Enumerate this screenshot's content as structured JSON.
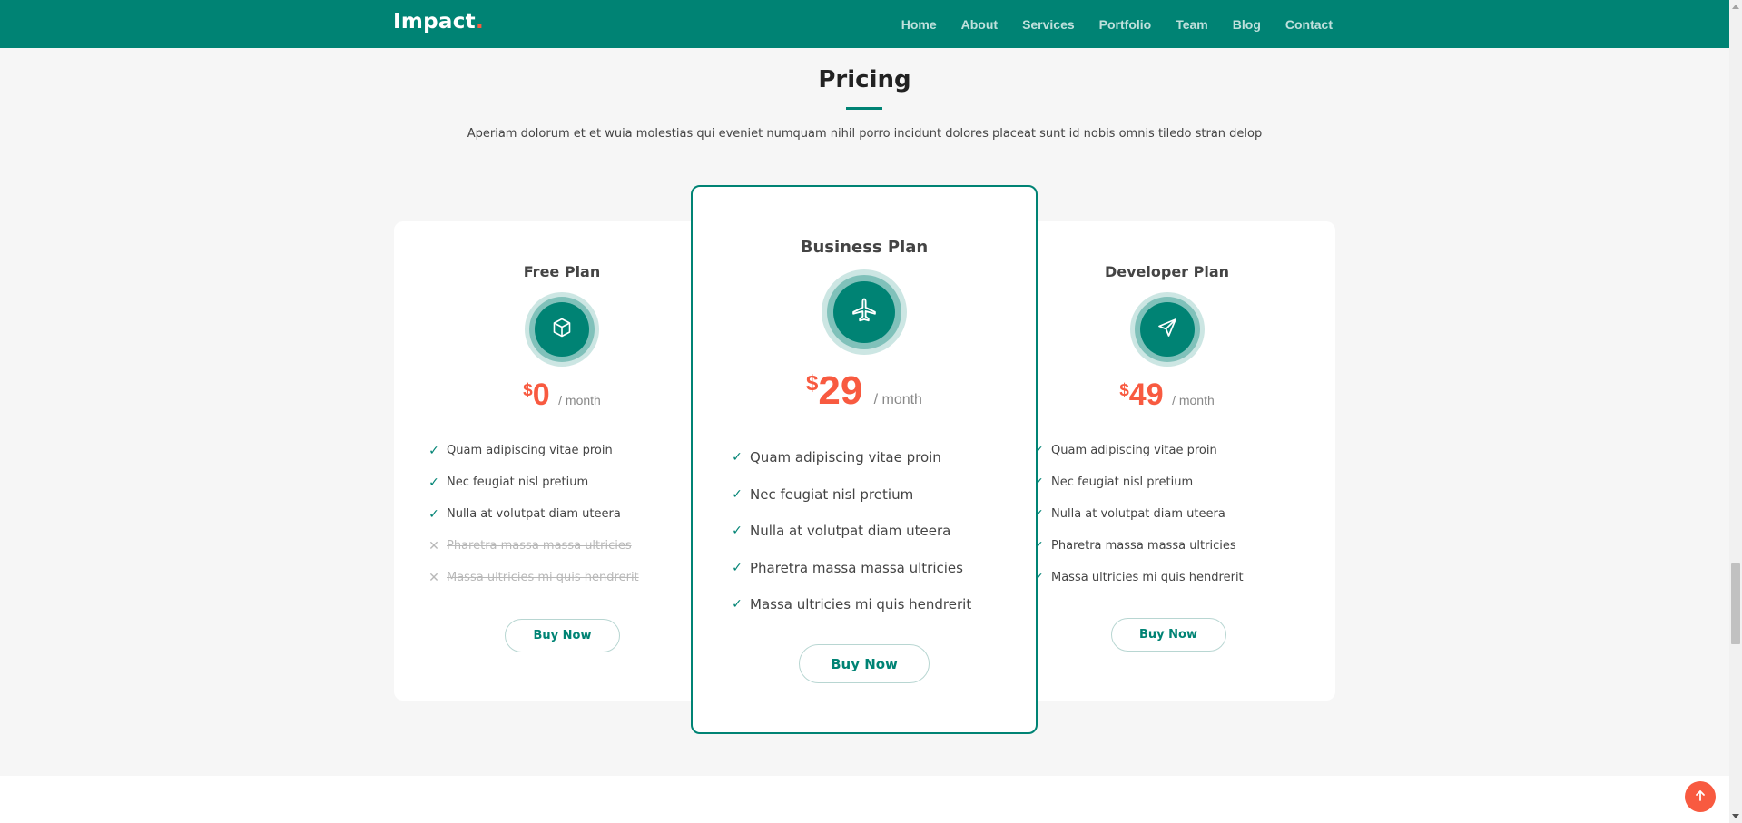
{
  "header": {
    "logo": "Impact",
    "logo_dot": ".",
    "nav": [
      "Home",
      "About",
      "Services",
      "Portfolio",
      "Team",
      "Blog",
      "Contact"
    ]
  },
  "section": {
    "title": "Pricing",
    "subtitle": "Aperiam dolorum et et wuia molestias qui eveniet numquam nihil porro incidunt dolores placeat sunt id nobis omnis tiledo stran delop"
  },
  "plans": [
    {
      "name": "Free Plan",
      "icon": "box-icon",
      "currency": "$",
      "price": "0",
      "period": "/ month",
      "features": [
        {
          "text": "Quam adipiscing vitae proin",
          "included": true
        },
        {
          "text": "Nec feugiat nisl pretium",
          "included": true
        },
        {
          "text": "Nulla at volutpat diam uteera",
          "included": true
        },
        {
          "text": "Pharetra massa massa ultricies",
          "included": false
        },
        {
          "text": "Massa ultricies mi quis hendrerit",
          "included": false
        }
      ],
      "button": "Buy Now"
    },
    {
      "name": "Business Plan",
      "icon": "airplane-icon",
      "currency": "$",
      "price": "29",
      "period": "/ month",
      "features": [
        {
          "text": "Quam adipiscing vitae proin",
          "included": true
        },
        {
          "text": "Nec feugiat nisl pretium",
          "included": true
        },
        {
          "text": "Nulla at volutpat diam uteera",
          "included": true
        },
        {
          "text": "Pharetra massa massa ultricies",
          "included": true
        },
        {
          "text": "Massa ultricies mi quis hendrerit",
          "included": true
        }
      ],
      "button": "Buy Now"
    },
    {
      "name": "Developer Plan",
      "icon": "send-icon",
      "currency": "$",
      "price": "49",
      "period": "/ month",
      "features": [
        {
          "text": "Quam adipiscing vitae proin",
          "included": true
        },
        {
          "text": "Nec feugiat nisl pretium",
          "included": true
        },
        {
          "text": "Nulla at volutpat diam uteera",
          "included": true
        },
        {
          "text": "Pharetra massa massa ultricies",
          "included": true
        },
        {
          "text": "Massa ultricies mi quis hendrerit",
          "included": true
        }
      ],
      "button": "Buy Now"
    }
  ],
  "colors": {
    "primary": "#008374",
    "accent": "#f85a40",
    "background": "#f6f6f6"
  },
  "back_to_top": {
    "icon": "arrow-up-icon"
  }
}
